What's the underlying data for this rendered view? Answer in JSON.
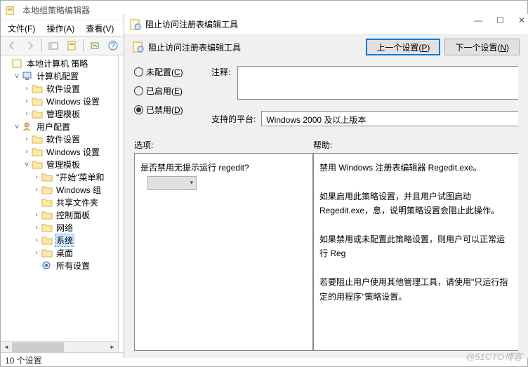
{
  "mainWindow": {
    "title": "本地组策略编辑器",
    "menu": {
      "file": "文件(F)",
      "action": "操作(A)",
      "view": "查看(V)"
    },
    "statusBar": "10 个设置"
  },
  "tree": {
    "root": "本地计算机 策略",
    "computerConfig": "计算机配置",
    "softwareSettings": "软件设置",
    "windowsSettings": "Windows 设置",
    "adminTemplates": "管理模板",
    "userConfig": "用户配置",
    "startMenu": "\"开始\"菜单和",
    "windowsComp": "Windows 组",
    "sharedFolders": "共享文件夹",
    "controlPanel": "控制面板",
    "network": "网络",
    "system": "系统",
    "desktop": "桌面",
    "allSettings": "所有设置"
  },
  "dialog": {
    "title": "阻止访问注册表编辑工具",
    "subTitle": "阻止访问注册表编辑工具",
    "prevBtn": "上一个设置(P)",
    "nextBtn": "下一个设置(N)",
    "radios": {
      "notConfigured": "未配置(C)",
      "enabled": "已启用(E)",
      "disabled": "已禁用(D)",
      "selected": "disabled"
    },
    "commentLabel": "注释:",
    "platformLabel": "支持的平台:",
    "platformValue": "Windows 2000 及以上版本",
    "optionsLabel": "选项:",
    "helpLabel": "帮助:",
    "optionsQuestion": "是否禁用无提示运行 regedit?",
    "help": {
      "p1": "禁用 Windows 注册表编辑器 Regedit.exe。",
      "p2": "如果启用此策略设置，并且用户试图启动 Regedit.exe，息，说明策略设置会阻止此操作。",
      "p3": "如果禁用或未配置此策略设置，则用户可以正常运行 Reg",
      "p4": "若要阻止用户使用其他管理工具，请使用\"只运行指定的用程序\"策略设置。"
    }
  },
  "watermark": "@51CTO博客"
}
